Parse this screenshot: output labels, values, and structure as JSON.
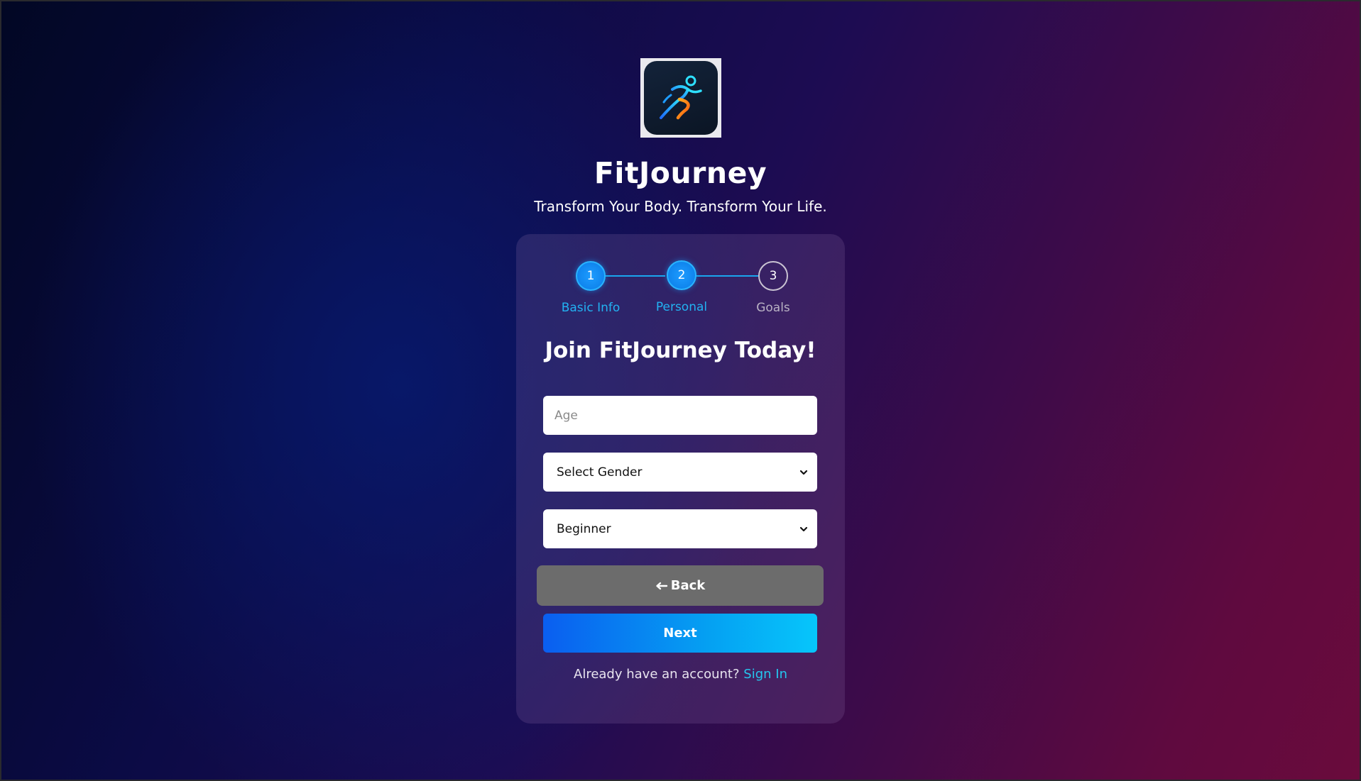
{
  "app": {
    "title": "FitJourney",
    "tagline": "Transform Your Body. Transform Your Life.",
    "logo_icon": "running-person-icon"
  },
  "stepper": {
    "current_step": 2,
    "steps": [
      {
        "number": "1",
        "label": "Basic Info",
        "state": "completed"
      },
      {
        "number": "2",
        "label": "Personal",
        "state": "active"
      },
      {
        "number": "3",
        "label": "Goals",
        "state": "pending"
      }
    ]
  },
  "form": {
    "title": "Join FitJourney Today!",
    "age_placeholder": "Age",
    "age_value": "",
    "gender_value": "Select Gender",
    "level_value": "Beginner",
    "back_label": "Back",
    "back_icon": "arrow-left-icon",
    "next_label": "Next"
  },
  "footer": {
    "prompt": "Already have an account?",
    "link": "Sign In"
  },
  "colors": {
    "accent": "#1aa6ee",
    "link": "#25c6ee",
    "back_button": "#6c6c6c",
    "next_gradient_start": "#0a5ef0",
    "next_gradient_end": "#06c6fb"
  }
}
